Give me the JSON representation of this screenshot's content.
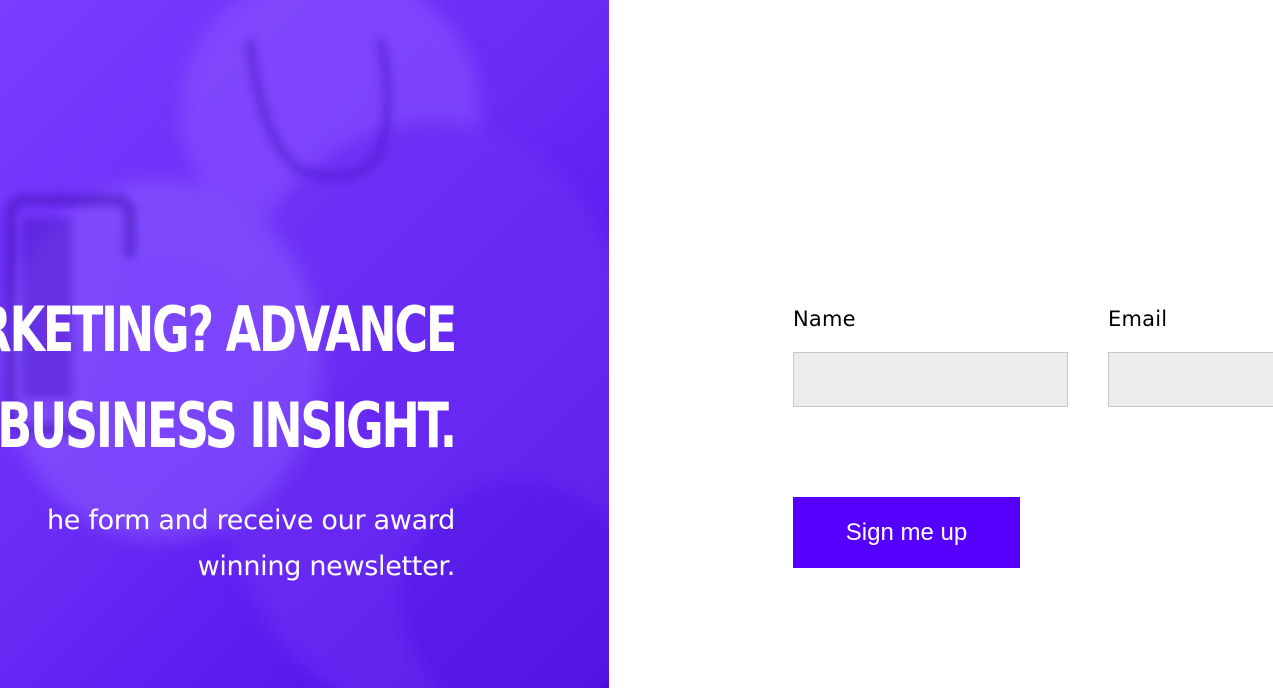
{
  "hero": {
    "headline_line1": "RKETING? ADVANCE",
    "headline_line2": "BUSINESS INSIGHT.",
    "subtext_line1": "he form and receive our award",
    "subtext_line2": "winning newsletter.",
    "colors": {
      "overlay": "#6a2cf6",
      "overlay_dark": "#4a06dc",
      "text": "#ffffff"
    }
  },
  "form": {
    "name_label": "Name",
    "name_value": "",
    "email_label": "Email",
    "email_value": "",
    "submit_label": "Sign me up",
    "colors": {
      "button": "#5500ff",
      "input_bg": "#ececec",
      "input_border": "#c7c7c7"
    }
  }
}
